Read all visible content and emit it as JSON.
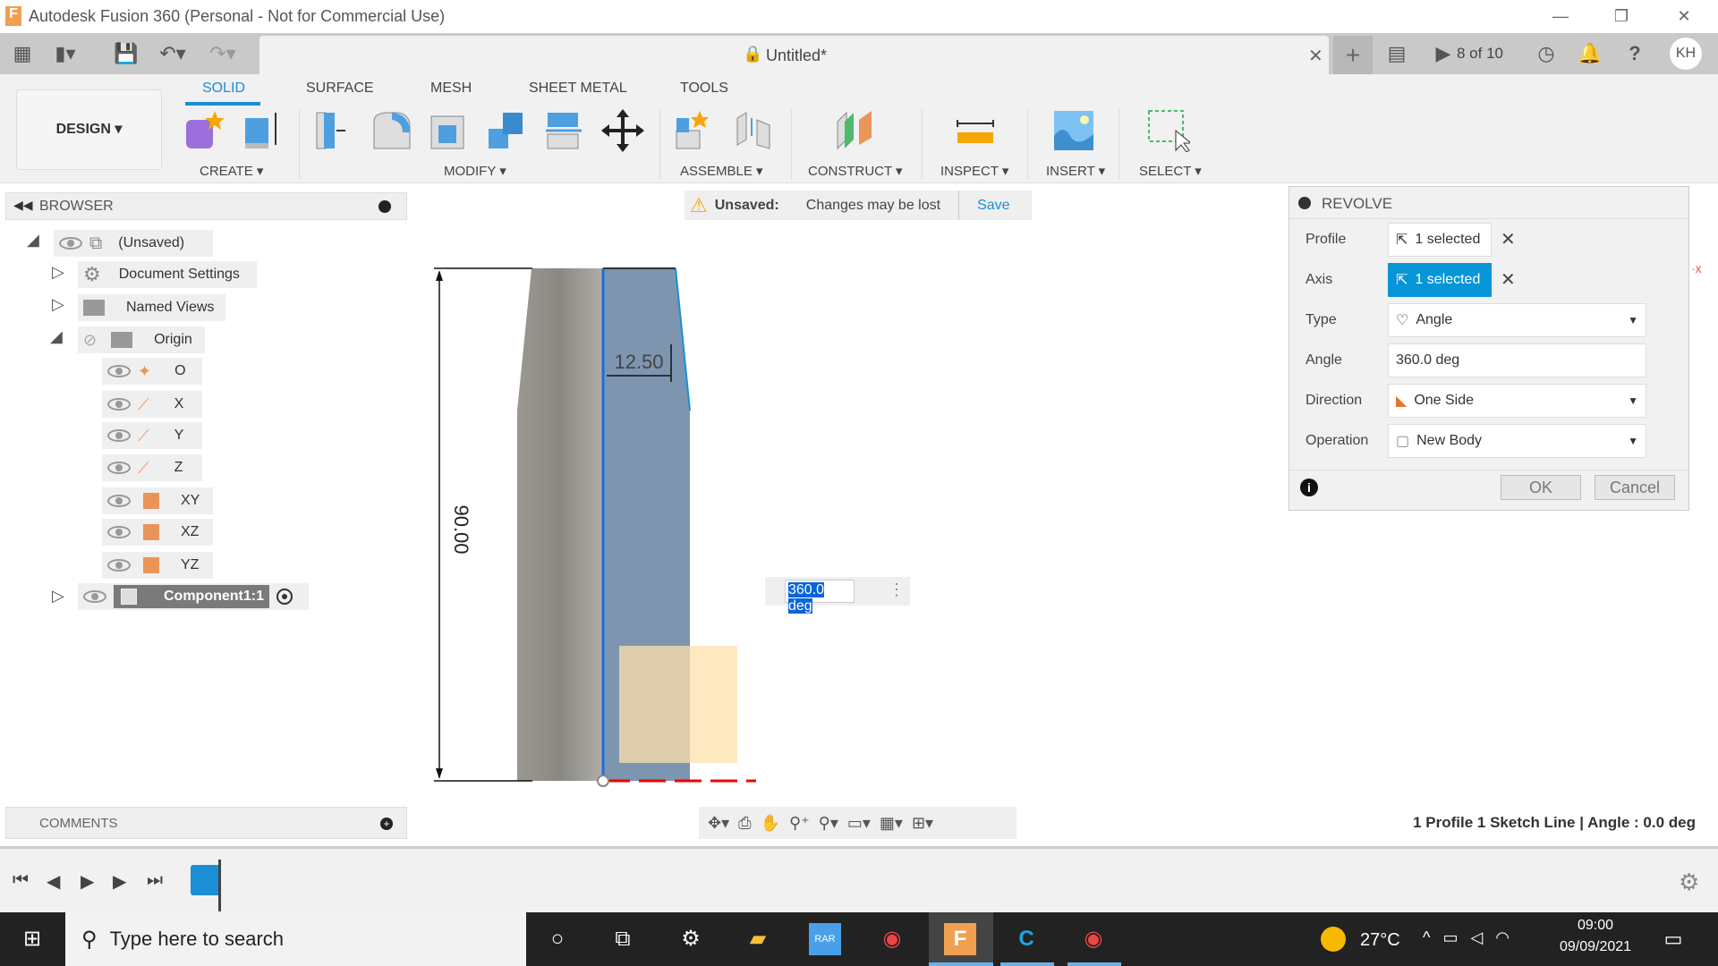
{
  "window": {
    "title": "Autodesk Fusion 360 (Personal - Not for Commercial Use)"
  },
  "qat": {
    "doc_title": "Untitled*",
    "job_status": "8 of 10",
    "user_initials": "KH"
  },
  "ribbon": {
    "workspace": "DESIGN ▾",
    "tabs": [
      "SOLID",
      "SURFACE",
      "MESH",
      "SHEET METAL",
      "TOOLS"
    ],
    "groups": [
      "CREATE ▾",
      "MODIFY ▾",
      "ASSEMBLE ▾",
      "CONSTRUCT ▾",
      "INSPECT ▾",
      "INSERT ▾",
      "SELECT ▾"
    ]
  },
  "browser": {
    "title": "BROWSER",
    "items": [
      {
        "label": "(Unsaved)"
      },
      {
        "label": "Document Settings"
      },
      {
        "label": "Named Views"
      },
      {
        "label": "Origin"
      },
      {
        "label": "O"
      },
      {
        "label": "X"
      },
      {
        "label": "Y"
      },
      {
        "label": "Z"
      },
      {
        "label": "XY"
      },
      {
        "label": "XZ"
      },
      {
        "label": "YZ"
      },
      {
        "label": "Component1:1"
      }
    ]
  },
  "banner": {
    "status": "Unsaved:",
    "message": "Changes may be lost",
    "save": "Save"
  },
  "sketch": {
    "height_dim": "90.00",
    "width_dim": "12.50",
    "angle_input": "360.0 deg"
  },
  "revolve": {
    "title": "REVOLVE",
    "profile_label": "Profile",
    "profile_value": "1 selected",
    "axis_label": "Axis",
    "axis_value": "1 selected",
    "type_label": "Type",
    "type_value": "Angle",
    "angle_label": "Angle",
    "angle_value": "360.0 deg",
    "direction_label": "Direction",
    "direction_value": "One Side",
    "operation_label": "Operation",
    "operation_value": "New Body",
    "ok": "OK",
    "cancel": "Cancel"
  },
  "comments": {
    "title": "COMMENTS"
  },
  "status": {
    "text": "1 Profile 1 Sketch Line | Angle : 0.0 deg"
  },
  "taskbar": {
    "search_placeholder": "Type here to search",
    "weather": "27°C",
    "time": "09:00",
    "date": "09/09/2021"
  },
  "colors": {
    "accent": "#0696d7",
    "selection_blue": "#1a8fd6",
    "body_gray": "#8c8a84",
    "profile_orange": "#fde0ac"
  }
}
